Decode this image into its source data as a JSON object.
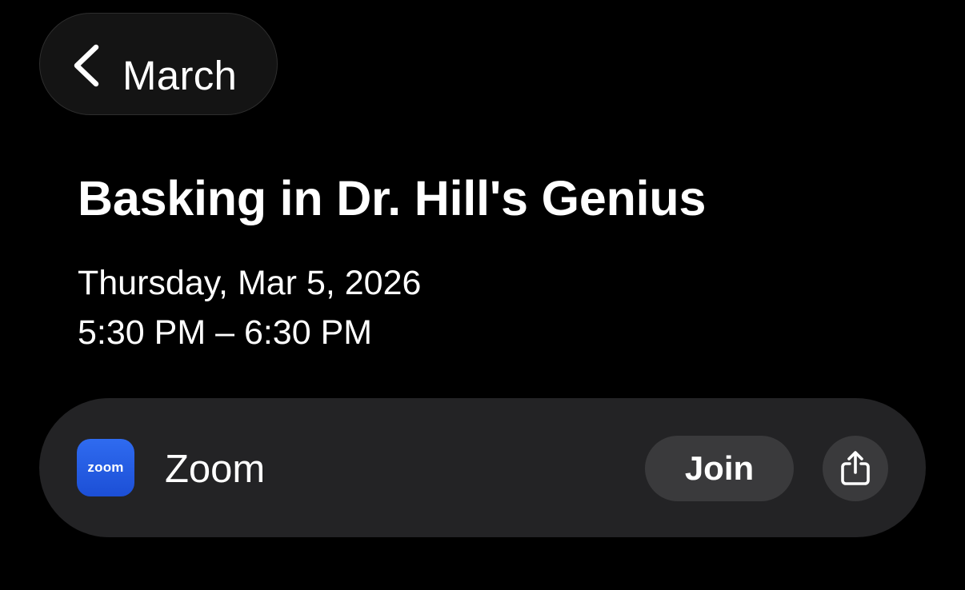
{
  "nav": {
    "back_label": "March",
    "back_icon": "chevron-left-icon"
  },
  "event": {
    "title": "Basking in Dr. Hill's Genius",
    "date": "Thursday, Mar 5, 2026",
    "time": "5:30 PM – 6:30 PM"
  },
  "call": {
    "logo_text": "zoom",
    "provider": "Zoom",
    "join_label": "Join",
    "share_icon": "share-icon"
  },
  "colors": {
    "background": "#000000",
    "card": "#232325",
    "button": "#3a3a3c",
    "zoom_blue": "#2f6bf0",
    "text": "#ffffff"
  }
}
